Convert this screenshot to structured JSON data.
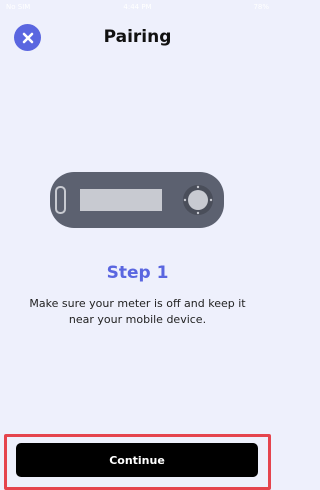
{
  "status_bar": {
    "carrier": "No SIM",
    "time": "4:44 PM",
    "battery": "78%"
  },
  "header": {
    "title": "Pairing"
  },
  "step": {
    "title": "Step 1",
    "description": "Make sure your meter is off and keep it near your mobile device."
  },
  "footer": {
    "continue_label": "Continue"
  },
  "colors": {
    "accent": "#5a66e0",
    "background": "#eef0fc",
    "button": "#000000",
    "highlight": "#e5444d"
  }
}
